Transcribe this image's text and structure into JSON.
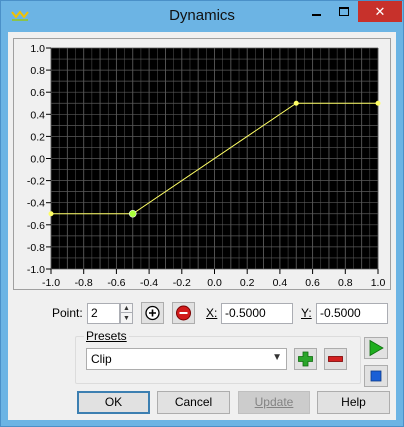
{
  "window": {
    "title": "Dynamics",
    "close_glyph": "✕"
  },
  "controls": {
    "point_label": "Point:",
    "point_value": "2",
    "x_label": "X:",
    "x_value": "-0.5000",
    "y_label": "Y:",
    "y_value": "-0.5000"
  },
  "presets": {
    "group_label": "Presets",
    "selected": "Clip"
  },
  "buttons": {
    "ok": "OK",
    "cancel": "Cancel",
    "update": "Update",
    "help": "Help"
  },
  "icons": {
    "add_point": "circle-plus-icon",
    "remove_point": "circle-minus-icon",
    "add_preset": "green-plus-icon",
    "remove_preset": "red-minus-icon",
    "play": "play-icon",
    "stop": "stop-icon"
  },
  "colors": {
    "plot_background": "#000000",
    "grid": "#5a5a5a",
    "curve": "#ffff66",
    "selected_point": "#a8ff3a",
    "titlebar": "#6cb4e4",
    "close_button": "#c7312b"
  },
  "chart_data": {
    "type": "line",
    "xlim": [
      -1.0,
      1.0
    ],
    "ylim": [
      -1.0,
      1.0
    ],
    "x_ticks": [
      "-1.0",
      "-0.8",
      "-0.6",
      "-0.4",
      "-0.2",
      "0.0",
      "0.2",
      "0.4",
      "0.6",
      "0.8",
      "1.0"
    ],
    "y_ticks": [
      "1.0",
      "0.8",
      "0.6",
      "0.4",
      "0.2",
      "0.0",
      "-0.2",
      "-0.4",
      "-0.6",
      "-0.8",
      "-1.0"
    ],
    "grid": true,
    "series": [
      {
        "points": [
          [
            -1.0,
            -0.5
          ],
          [
            -0.5,
            -0.5
          ],
          [
            0.5,
            0.5
          ],
          [
            1.0,
            0.5
          ]
        ]
      }
    ],
    "selected_point_index": 1
  }
}
